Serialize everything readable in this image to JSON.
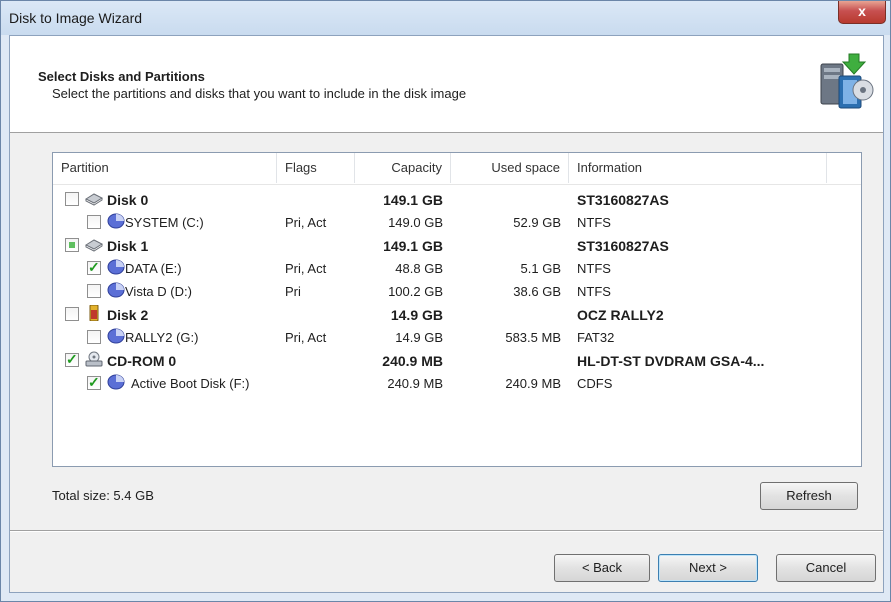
{
  "window": {
    "title": "Disk to Image Wizard",
    "close_glyph": "x"
  },
  "header": {
    "title": "Select Disks and Partitions",
    "subtitle": "Select the partitions and disks that you want to include in the disk image",
    "icon": "computer-disk-arrow-icon"
  },
  "table": {
    "columns": [
      "Partition",
      "Flags",
      "Capacity",
      "Used space",
      "Information"
    ],
    "rows": [
      {
        "level": 0,
        "checkbox": "unchecked",
        "icon": "hard-disk-icon",
        "name": "Disk 0",
        "flags": "",
        "capacity": "149.1 GB",
        "used": "",
        "info": "ST3160827AS",
        "bold": true
      },
      {
        "level": 1,
        "checkbox": "unchecked",
        "icon": "partition-icon",
        "name": "SYSTEM (C:)",
        "flags": "Pri, Act",
        "capacity": "149.0 GB",
        "used": "52.9 GB",
        "info": "NTFS",
        "bold": false
      },
      {
        "level": 0,
        "checkbox": "partial",
        "icon": "hard-disk-icon",
        "name": "Disk 1",
        "flags": "",
        "capacity": "149.1 GB",
        "used": "",
        "info": "ST3160827AS",
        "bold": true
      },
      {
        "level": 1,
        "checkbox": "checked",
        "icon": "partition-icon",
        "name": "DATA (E:)",
        "flags": "Pri, Act",
        "capacity": "48.8 GB",
        "used": "5.1 GB",
        "info": "NTFS",
        "bold": false
      },
      {
        "level": 1,
        "checkbox": "unchecked",
        "icon": "partition-icon",
        "name": "Vista D (D:)",
        "flags": "Pri",
        "capacity": "100.2 GB",
        "used": "38.6 GB",
        "info": "NTFS",
        "bold": false
      },
      {
        "level": 0,
        "checkbox": "unchecked",
        "icon": "usb-drive-icon",
        "name": "Disk 2",
        "flags": "",
        "capacity": "14.9 GB",
        "used": "",
        "info": "OCZ RALLY2",
        "bold": true
      },
      {
        "level": 1,
        "checkbox": "unchecked",
        "icon": "partition-icon",
        "name": "RALLY2 (G:)",
        "flags": "Pri, Act",
        "capacity": "14.9 GB",
        "used": "583.5 MB",
        "info": "FAT32",
        "bold": false
      },
      {
        "level": 0,
        "checkbox": "checked",
        "icon": "cd-rom-icon",
        "name": "CD-ROM 0",
        "flags": "",
        "capacity": "240.9 MB",
        "used": "",
        "info": "HL-DT-ST DVDRAM GSA-4...",
        "bold": true
      },
      {
        "level": 1,
        "checkbox": "checked",
        "icon": "partition-icon",
        "name": "Active Boot Disk (F:)",
        "flags": "",
        "capacity": "240.9 MB",
        "used": "240.9 MB",
        "info": "CDFS",
        "bold": false
      }
    ]
  },
  "total_size": "Total size: 5.4 GB",
  "buttons": {
    "refresh": "Refresh",
    "back": "< Back",
    "next": "Next >",
    "cancel": "Cancel"
  }
}
